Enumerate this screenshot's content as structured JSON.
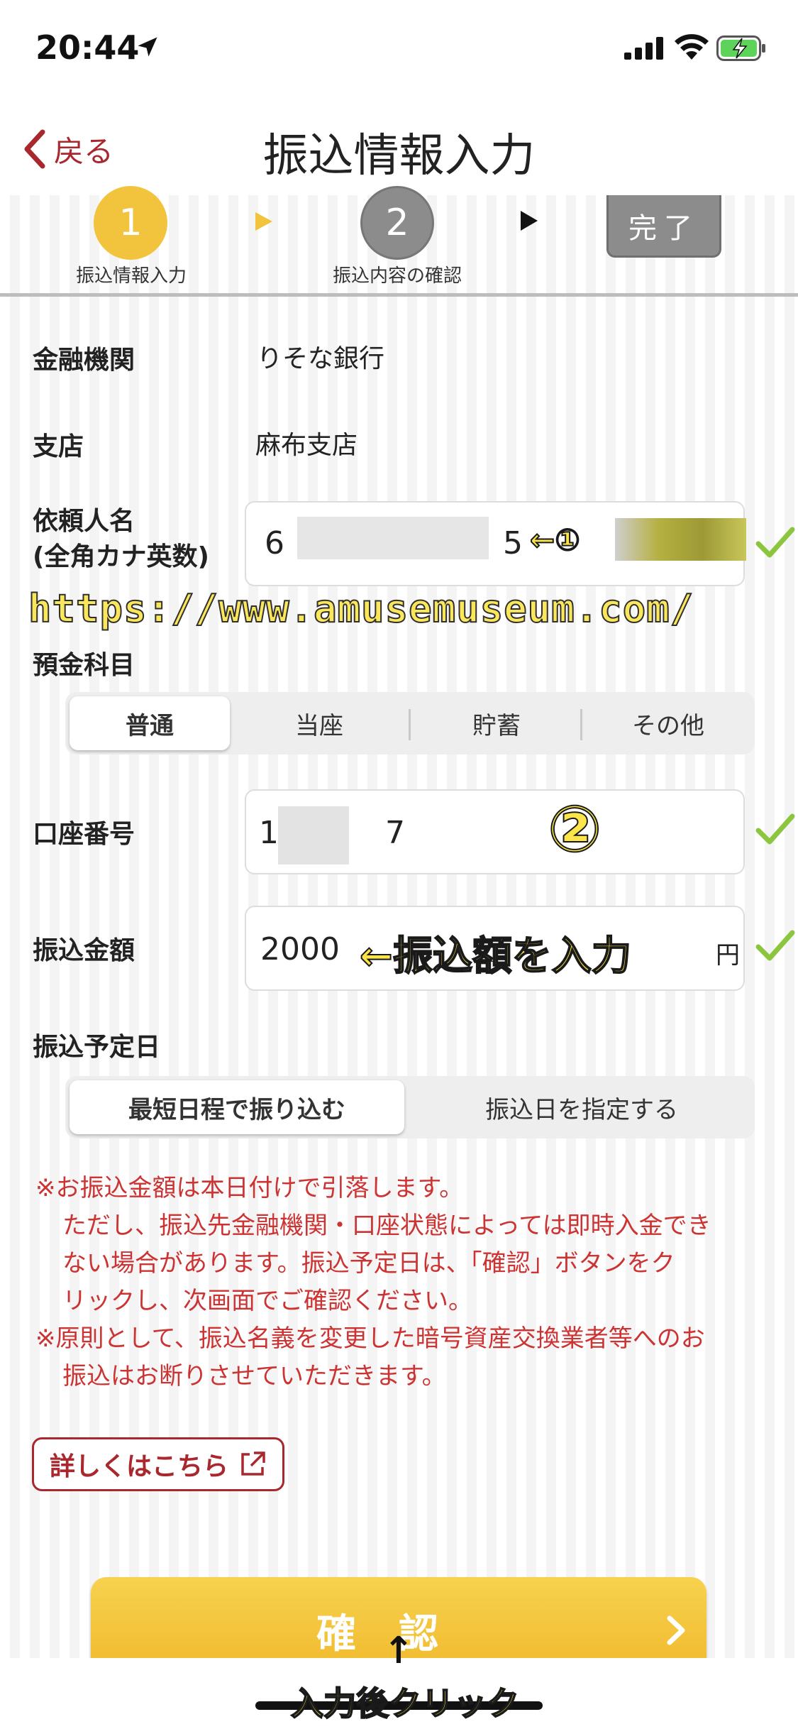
{
  "status_bar": {
    "time": "20:44"
  },
  "nav": {
    "back_label": "戻る",
    "title": "振込情報入力"
  },
  "steps": [
    {
      "number": "1",
      "label": "振込情報入力"
    },
    {
      "number": "2",
      "label": "振込内容の確認"
    },
    {
      "label": "完了"
    }
  ],
  "form": {
    "bank": {
      "label": "金融機関",
      "value": "りそな銀行"
    },
    "branch": {
      "label": "支店",
      "value": "麻布支店"
    },
    "requester": {
      "label_line1": "依頼人名",
      "label_line2": "(全角カナ英数)",
      "value_prefix": "6",
      "value_suffix": "5"
    },
    "account_type": {
      "label": "預金科目",
      "options": [
        "普通",
        "当座",
        "貯蓄",
        "その他"
      ],
      "selected": "普通"
    },
    "account_number": {
      "label": "口座番号",
      "value_prefix": "1",
      "value_suffix": "7"
    },
    "amount": {
      "label": "振込金額",
      "value": "2000",
      "unit": "円"
    },
    "schedule": {
      "label": "振込予定日",
      "options": [
        "最短日程で振り込む",
        "振込日を指定する"
      ],
      "selected": "最短日程で振り込む"
    }
  },
  "notice": {
    "line1": "※お振込金額は本日付けで引落します。",
    "line2": "ただし、振込先金融機関・口座状態によっては即時入金でき",
    "line3": "ない場合があります。振込予定日は、「確認」ボタンをク",
    "line4": "リックし、次画面でご確認ください。",
    "line5": "※原則として、振込名義を変更した暗号資産交換業者等へのお",
    "line6": "振込はお断りさせていただきます。"
  },
  "detail_link": "詳しくはこちら",
  "confirm_button": "確認",
  "annotations": {
    "url_watermark": "https://www.amusemuseum.com/",
    "marker1": "←①",
    "marker2": "②",
    "amount_note": "←振込額を入力",
    "bottom_arrow": "↑",
    "bottom_note": "入力後クリック"
  },
  "colors": {
    "accent_red": "#a8282e",
    "step_yellow": "#f2c33c",
    "notice_red": "#cc3333",
    "check_green": "#8cc63f"
  }
}
